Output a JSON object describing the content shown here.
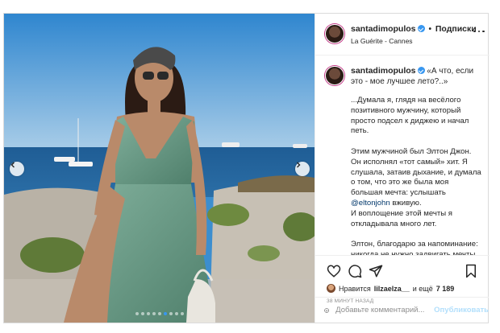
{
  "post": {
    "username": "santadimopulos",
    "separator": "•",
    "follow_label": "Подписки",
    "location": "La Guérite - Cannes",
    "caption_title": "«А что, если это - мое лучшее лето?..»",
    "caption_text_1": "...Думала я, глядя на весёлого позитивного мужчину, который просто подсел к диджею и начал петь.\n\nЭтим мужчиной был Элтон Джон. Он исполнял «тот самый» хит. Я слушала, затаив дыхание, и думала о том, что это же была моя большая мечта: услышать ",
    "caption_mention": "@eltonjohn",
    "caption_text_2": " вживую.\nИ воплощение этой мечты я откладывала много лет.\n\nЭлтон, благодарю за напоминание: никогда не нужно задвигать мечты в",
    "likes_prefix": "Нравится",
    "likes_user": "lilzaelza__",
    "likes_suffix": "и ещё",
    "likes_count": "7 189",
    "time_ago": "38 МИНУТ НАЗАД",
    "comment_placeholder": "Добавьте комментарий...",
    "post_label": "Опубликовать",
    "carousel": {
      "total": 9,
      "active_index": 5
    }
  },
  "colors": {
    "accent": "#3897f0",
    "post_disabled": "#b2dffc",
    "text": "#262626",
    "muted": "#8e8e8e"
  },
  "icons": [
    "chevron-left-icon",
    "chevron-right-icon",
    "more-icon",
    "heart-icon",
    "comment-icon",
    "share-icon",
    "bookmark-icon",
    "emoji-icon",
    "verified-icon"
  ]
}
